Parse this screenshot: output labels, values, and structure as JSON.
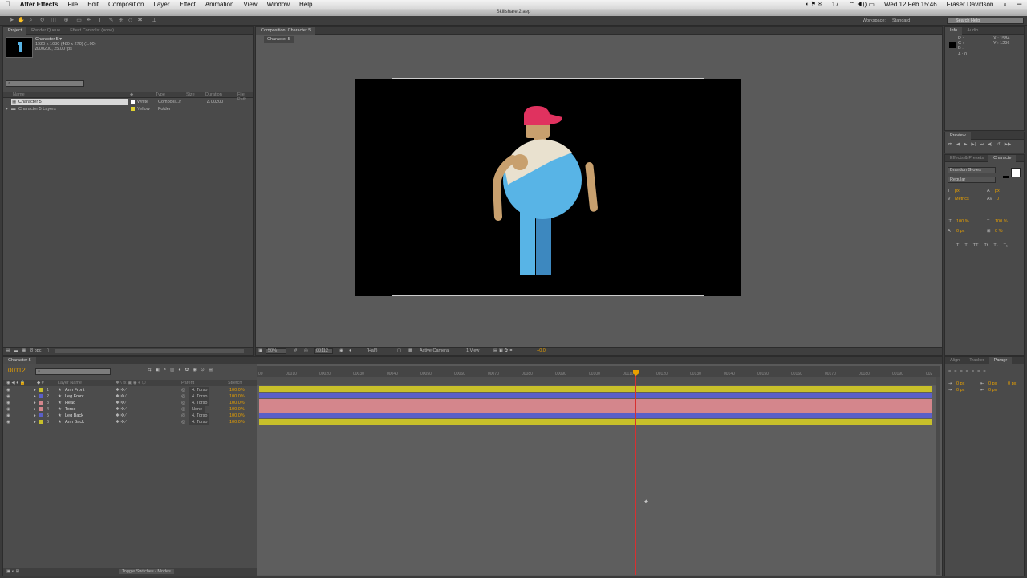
{
  "menubar": {
    "app": "After Effects",
    "items": [
      "File",
      "Edit",
      "Composition",
      "Layer",
      "Effect",
      "Animation",
      "View",
      "Window",
      "Help"
    ],
    "status": [
      "17",
      "Wed 12 Feb 15:46",
      "Fraser Davidson"
    ]
  },
  "window_title": "Skillshare 2.aep",
  "workspace": {
    "label": "Workspace:",
    "value": "Standard"
  },
  "search_help": "Search Help",
  "project": {
    "tabs": [
      "Project",
      "Render Queue",
      "Effect Controls: (none)"
    ],
    "selected_name": "Character 5 ▾",
    "selected_info": [
      "1920 x 1080 (480 x 270) (1.00)",
      "Δ 00200, 25.00 fps"
    ],
    "columns": [
      "Name",
      "Type",
      "Size",
      "Duration",
      "File Path"
    ],
    "items": [
      {
        "name": "Character 5",
        "label": "White",
        "type": "Composi...n",
        "duration": "Δ 00200"
      },
      {
        "name": "Character 5 Layers",
        "label": "Yellow",
        "type": "Folder",
        "duration": ""
      }
    ],
    "bpc": "8 bpc"
  },
  "composition": {
    "tab": "Composition: Character 5",
    "subtab": "Character 5",
    "zoom": "50%",
    "timecode": "00112",
    "resolution": "(Half)",
    "camera": "Active Camera",
    "views": "1 View",
    "exposure": "+0.0"
  },
  "info": {
    "tabs": [
      "Info",
      "Audio"
    ],
    "r": "R :",
    "g": "G :",
    "b": "B :",
    "a": "A : 0",
    "x": "X : 1584",
    "y": "Y : 1296"
  },
  "preview": {
    "tab": "Preview"
  },
  "character": {
    "tabs": [
      "Effects & Presets",
      "Characte"
    ],
    "font": "Brandon Grotes",
    "style": "Regular",
    "size": "px",
    "leading": "px",
    "kerning": "Metrics",
    "tracking": "0",
    "vscale": "100 %",
    "hscale": "100 %",
    "baseline": "0 px",
    "tsume": "0 %"
  },
  "paragraph": {
    "tabs": [
      "Align",
      "Tracker",
      "Paragr"
    ],
    "values": [
      "0 px",
      "0 px",
      "0 px",
      "0 px",
      "0 px"
    ]
  },
  "timeline": {
    "tab": "Character 5",
    "timecode": "00112",
    "col_source": "Layer Name",
    "col_parent": "Parent",
    "col_stretch": "Stretch",
    "layers": [
      {
        "num": "1",
        "name": "Arm Front",
        "color": "#c8c02a",
        "parent": "4. Torso",
        "stretch": "100.0%"
      },
      {
        "num": "2",
        "name": "Leg Front",
        "color": "#5a5fc8",
        "parent": "4. Torso",
        "stretch": "100.0%"
      },
      {
        "num": "3",
        "name": "Head",
        "color": "#d4868c",
        "parent": "4. Torso",
        "stretch": "100.0%"
      },
      {
        "num": "4",
        "name": "Torso",
        "color": "#d4868c",
        "parent": "None",
        "stretch": "100.0%"
      },
      {
        "num": "5",
        "name": "Leg Back",
        "color": "#5a5fc8",
        "parent": "4. Torso",
        "stretch": "100.0%"
      },
      {
        "num": "6",
        "name": "Arm Back",
        "color": "#c8c02a",
        "parent": "4. Torso",
        "stretch": "100.0%"
      }
    ],
    "ruler": [
      "00",
      "00010",
      "00020",
      "00030",
      "00040",
      "00050",
      "00060",
      "00070",
      "00080",
      "00090",
      "00100",
      "00110",
      "00120",
      "00130",
      "00140",
      "00150",
      "00160",
      "00170",
      "00180",
      "00190",
      "002"
    ],
    "toggle": "Toggle Switches / Modes"
  },
  "colors": {
    "accent": "#e8a000",
    "playhead": "#d83030",
    "cap": "#e0325f",
    "shirt": "#58b4e6",
    "skin": "#c8a06e"
  }
}
